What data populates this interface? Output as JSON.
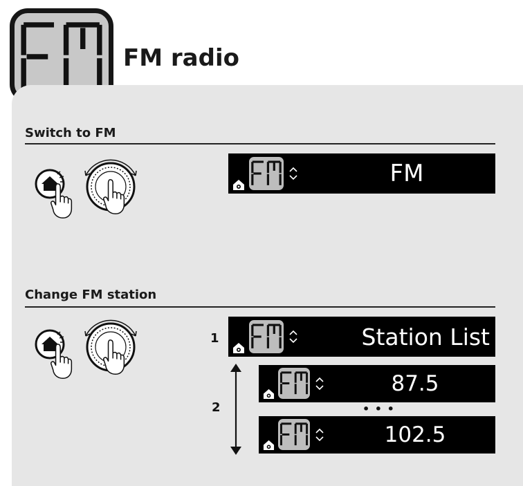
{
  "header": {
    "icon_text": "FM",
    "title": "FM radio"
  },
  "sections": [
    {
      "title": "Switch to FM",
      "display": "FM"
    },
    {
      "title": "Change FM station",
      "steps": [
        {
          "number": "1",
          "display": "Station List"
        },
        {
          "number": "2",
          "display_first": "87.5",
          "ellipsis": "• • •",
          "display_last": "102.5"
        }
      ]
    }
  ],
  "icons": {
    "home_button": "home-button-press-icon",
    "dial": "rotary-dial-icon",
    "mode_indicator": "fm-mode-lcd-icon",
    "up_down": "up-down-chevron-icon",
    "small_home": "home-badge-icon",
    "range_arrow": "double-headed-arrow-icon"
  }
}
